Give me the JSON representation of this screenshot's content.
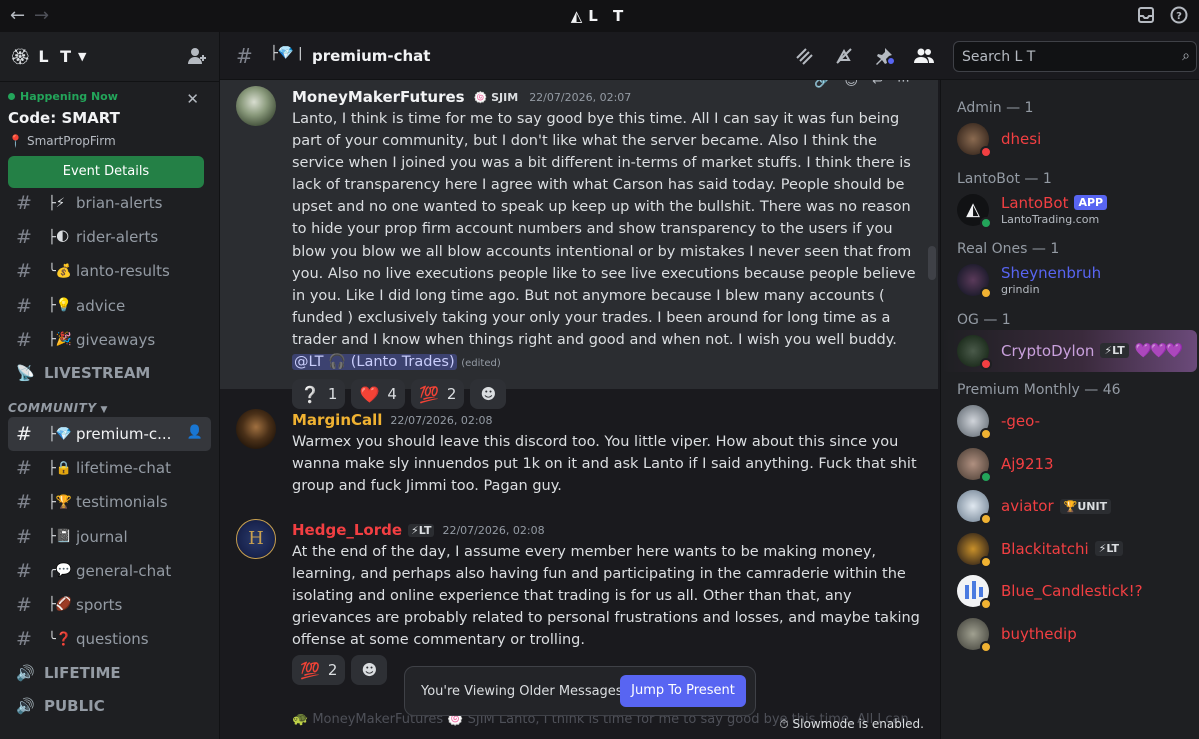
{
  "titlebar": {
    "back": "←",
    "forward": "→",
    "title": "L T",
    "logo": "◭"
  },
  "sidebar": {
    "server_name": "L T",
    "server_icon": "🏵",
    "event": {
      "status": "Happening Now",
      "title": "Code: SMART",
      "location": "SmartPropFirm",
      "button": "Event Details"
    },
    "channels_top": [
      {
        "prefix": "├⚡",
        "label": "brian-alerts"
      },
      {
        "prefix": "├🌓",
        "label": "rider-alerts"
      },
      {
        "prefix": "╰💰",
        "label": "lanto-results"
      },
      {
        "prefix": "├💡",
        "label": "advice"
      },
      {
        "prefix": "├🎉",
        "label": "giveaways"
      }
    ],
    "livestream": "LIVESTREAM",
    "community_label": "COMMUNITY",
    "channels_community": [
      {
        "prefix": "├💎",
        "label": "premium-c..."
      },
      {
        "prefix": "├🔒",
        "label": "lifetime-chat"
      },
      {
        "prefix": "├🏆",
        "label": "testimonials"
      },
      {
        "prefix": "├📓",
        "label": "journal"
      },
      {
        "prefix": "╭💬",
        "label": "general-chat"
      },
      {
        "prefix": "├🏈",
        "label": "sports"
      },
      {
        "prefix": "╰❓",
        "label": "questions"
      }
    ],
    "lifetime": "LIFETIME",
    "public": "PUBLIC"
  },
  "header": {
    "channel_prefix": "├💎 |",
    "channel_name": "premium-chat",
    "search_placeholder": "Search L T"
  },
  "messages": [
    {
      "author": "MoneyMakerFutures",
      "author_color": "#f2f3f5",
      "tag": "🍥 SJIM",
      "timestamp": "22/07/2026, 02:07",
      "text": "Lanto, I think is time for me to say good bye this time. All I can say it was fun being part of your community, but I don't like what the server became. Also I think the service when I joined you was a bit different in-terms of market stuffs. I think there is lack of transparency here I agree with what Carson has said today. People should be upset and no one wanted to speak up keep up with the bullshit. There was no reason to hide your prop firm account numbers and show transparency to the users if you blow you blow we all blow accounts intentional or by mistakes I never seen that from you. Also no live executions  people like to see live executions because people believe in you. Like I did long time ago. But not anymore because I blew many accounts ( funded ) exclusively taking your only your trades. I been around for long time as a trader and I know when things right and good and when not. I wish you well buddy.",
      "mention": "@LT 🎧 (Lanto Trades)",
      "edited": "(edited)",
      "reactions": [
        {
          "emoji": "❔",
          "count": "1"
        },
        {
          "emoji": "❤️",
          "count": "4"
        },
        {
          "emoji": "💯",
          "count": "2"
        }
      ]
    },
    {
      "author": "MarginCall",
      "author_color": "#f0b232",
      "timestamp": "22/07/2026, 02:08",
      "text": "Warmex you should leave this discord too. You little viper. How about this since you wanna make sly innuendos put 1k on it and ask Lanto if I said anything. Fuck that shit group and fuck Jimmi too. Pagan guy."
    },
    {
      "author": "Hedge_Lorde",
      "author_color": "#f23f42",
      "tag": "⚡LT",
      "timestamp": "22/07/2026, 02:08",
      "text": "At the end of the day, I assume every member here wants to be making money, learning, and perhaps also having fun and participating in the camraderie within the isolating and online experience that trading is for us all.  Other than that, any grievances are probably related to personal frustrations and losses, and maybe taking offense at some commentary or trolling.",
      "reactions": [
        {
          "emoji": "💯",
          "count": "2"
        }
      ]
    }
  ],
  "older_bar": {
    "text": "You're Viewing Older Messages",
    "button": "Jump To Present"
  },
  "ghost_text": "🐢 MoneyMakerFutures  🍥 SJIM  Lanto, I think is time for me to say good bye this time. All I can",
  "slowmode": "Slowmode is enabled.",
  "members": {
    "groups": [
      {
        "title": "Admin — 1",
        "members": [
          {
            "name": "dhesi",
            "color": "#f23f42",
            "status": "#f23f42"
          }
        ]
      },
      {
        "title": "LantoBot — 1",
        "members": [
          {
            "name": "LantoBot",
            "color": "#f23f42",
            "badge": "APP",
            "sub": "LantoTrading.com",
            "status": "#23a55a"
          }
        ]
      },
      {
        "title": "Real Ones — 1",
        "members": [
          {
            "name": "Sheynenbruh",
            "color": "#5865f2",
            "sub": "grindin",
            "status": "#f0b232"
          }
        ]
      },
      {
        "title": "OG — 1",
        "members": [
          {
            "name": "CryptoDylon",
            "color": "#c9a0dc",
            "role": "⚡LT",
            "hearts": "💜💜💜",
            "status": "#f23f42"
          }
        ]
      },
      {
        "title": "Premium Monthly — 46",
        "members": [
          {
            "name": "-geo-",
            "color": "#f23f42",
            "status": "#f0b232"
          },
          {
            "name": "Aj9213",
            "color": "#f23f42",
            "status": "#23a55a"
          },
          {
            "name": "aviator",
            "color": "#f23f42",
            "role": "🏆UNIT",
            "status": "#f0b232"
          },
          {
            "name": "Blackitatchi",
            "color": "#f23f42",
            "role": "⚡LT",
            "status": "#f0b232"
          },
          {
            "name": "Blue_Candlestick!?",
            "color": "#f23f42",
            "status": "#f0b232"
          },
          {
            "name": "buythedip",
            "color": "#f23f42",
            "status": "#f0b232"
          }
        ]
      }
    ]
  }
}
